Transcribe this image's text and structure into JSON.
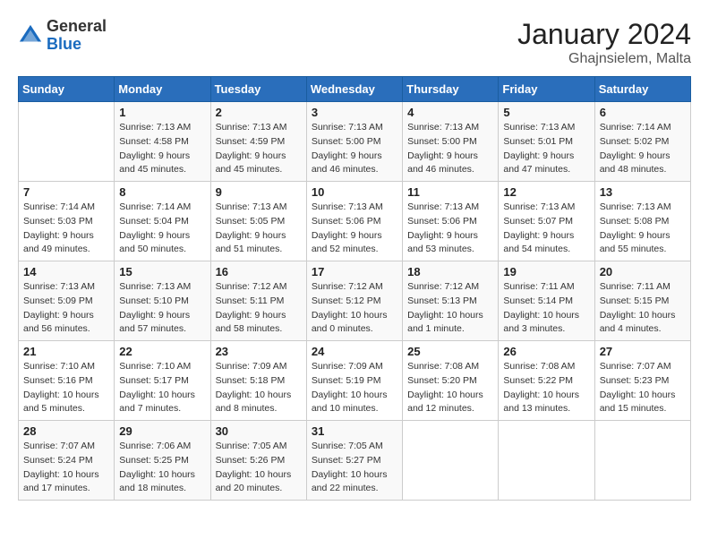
{
  "header": {
    "logo_general": "General",
    "logo_blue": "Blue",
    "month_year": "January 2024",
    "location": "Ghajnsielem, Malta"
  },
  "days_of_week": [
    "Sunday",
    "Monday",
    "Tuesday",
    "Wednesday",
    "Thursday",
    "Friday",
    "Saturday"
  ],
  "weeks": [
    [
      {
        "day": "",
        "info": ""
      },
      {
        "day": "1",
        "info": "Sunrise: 7:13 AM\nSunset: 4:58 PM\nDaylight: 9 hours\nand 45 minutes."
      },
      {
        "day": "2",
        "info": "Sunrise: 7:13 AM\nSunset: 4:59 PM\nDaylight: 9 hours\nand 45 minutes."
      },
      {
        "day": "3",
        "info": "Sunrise: 7:13 AM\nSunset: 5:00 PM\nDaylight: 9 hours\nand 46 minutes."
      },
      {
        "day": "4",
        "info": "Sunrise: 7:13 AM\nSunset: 5:00 PM\nDaylight: 9 hours\nand 46 minutes."
      },
      {
        "day": "5",
        "info": "Sunrise: 7:13 AM\nSunset: 5:01 PM\nDaylight: 9 hours\nand 47 minutes."
      },
      {
        "day": "6",
        "info": "Sunrise: 7:14 AM\nSunset: 5:02 PM\nDaylight: 9 hours\nand 48 minutes."
      }
    ],
    [
      {
        "day": "7",
        "info": "Sunrise: 7:14 AM\nSunset: 5:03 PM\nDaylight: 9 hours\nand 49 minutes."
      },
      {
        "day": "8",
        "info": "Sunrise: 7:14 AM\nSunset: 5:04 PM\nDaylight: 9 hours\nand 50 minutes."
      },
      {
        "day": "9",
        "info": "Sunrise: 7:13 AM\nSunset: 5:05 PM\nDaylight: 9 hours\nand 51 minutes."
      },
      {
        "day": "10",
        "info": "Sunrise: 7:13 AM\nSunset: 5:06 PM\nDaylight: 9 hours\nand 52 minutes."
      },
      {
        "day": "11",
        "info": "Sunrise: 7:13 AM\nSunset: 5:06 PM\nDaylight: 9 hours\nand 53 minutes."
      },
      {
        "day": "12",
        "info": "Sunrise: 7:13 AM\nSunset: 5:07 PM\nDaylight: 9 hours\nand 54 minutes."
      },
      {
        "day": "13",
        "info": "Sunrise: 7:13 AM\nSunset: 5:08 PM\nDaylight: 9 hours\nand 55 minutes."
      }
    ],
    [
      {
        "day": "14",
        "info": "Sunrise: 7:13 AM\nSunset: 5:09 PM\nDaylight: 9 hours\nand 56 minutes."
      },
      {
        "day": "15",
        "info": "Sunrise: 7:13 AM\nSunset: 5:10 PM\nDaylight: 9 hours\nand 57 minutes."
      },
      {
        "day": "16",
        "info": "Sunrise: 7:12 AM\nSunset: 5:11 PM\nDaylight: 9 hours\nand 58 minutes."
      },
      {
        "day": "17",
        "info": "Sunrise: 7:12 AM\nSunset: 5:12 PM\nDaylight: 10 hours\nand 0 minutes."
      },
      {
        "day": "18",
        "info": "Sunrise: 7:12 AM\nSunset: 5:13 PM\nDaylight: 10 hours\nand 1 minute."
      },
      {
        "day": "19",
        "info": "Sunrise: 7:11 AM\nSunset: 5:14 PM\nDaylight: 10 hours\nand 3 minutes."
      },
      {
        "day": "20",
        "info": "Sunrise: 7:11 AM\nSunset: 5:15 PM\nDaylight: 10 hours\nand 4 minutes."
      }
    ],
    [
      {
        "day": "21",
        "info": "Sunrise: 7:10 AM\nSunset: 5:16 PM\nDaylight: 10 hours\nand 5 minutes."
      },
      {
        "day": "22",
        "info": "Sunrise: 7:10 AM\nSunset: 5:17 PM\nDaylight: 10 hours\nand 7 minutes."
      },
      {
        "day": "23",
        "info": "Sunrise: 7:09 AM\nSunset: 5:18 PM\nDaylight: 10 hours\nand 8 minutes."
      },
      {
        "day": "24",
        "info": "Sunrise: 7:09 AM\nSunset: 5:19 PM\nDaylight: 10 hours\nand 10 minutes."
      },
      {
        "day": "25",
        "info": "Sunrise: 7:08 AM\nSunset: 5:20 PM\nDaylight: 10 hours\nand 12 minutes."
      },
      {
        "day": "26",
        "info": "Sunrise: 7:08 AM\nSunset: 5:22 PM\nDaylight: 10 hours\nand 13 minutes."
      },
      {
        "day": "27",
        "info": "Sunrise: 7:07 AM\nSunset: 5:23 PM\nDaylight: 10 hours\nand 15 minutes."
      }
    ],
    [
      {
        "day": "28",
        "info": "Sunrise: 7:07 AM\nSunset: 5:24 PM\nDaylight: 10 hours\nand 17 minutes."
      },
      {
        "day": "29",
        "info": "Sunrise: 7:06 AM\nSunset: 5:25 PM\nDaylight: 10 hours\nand 18 minutes."
      },
      {
        "day": "30",
        "info": "Sunrise: 7:05 AM\nSunset: 5:26 PM\nDaylight: 10 hours\nand 20 minutes."
      },
      {
        "day": "31",
        "info": "Sunrise: 7:05 AM\nSunset: 5:27 PM\nDaylight: 10 hours\nand 22 minutes."
      },
      {
        "day": "",
        "info": ""
      },
      {
        "day": "",
        "info": ""
      },
      {
        "day": "",
        "info": ""
      }
    ]
  ]
}
